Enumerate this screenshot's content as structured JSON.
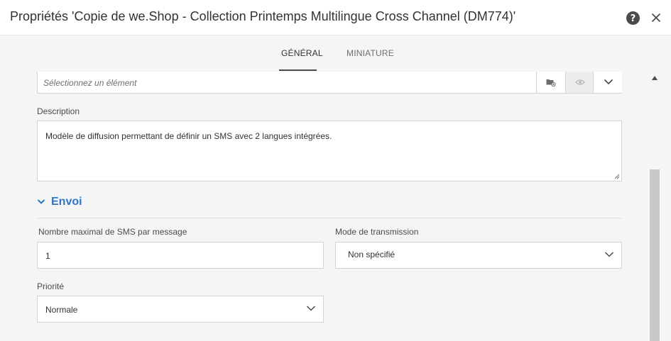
{
  "dialog": {
    "title": "Propriétés 'Copie de we.Shop - Collection Printemps Multilingue Cross Channel (DM774)'"
  },
  "tabs": [
    {
      "label": "GÉNÉRAL",
      "active": true
    },
    {
      "label": "MINIATURE",
      "active": false
    }
  ],
  "select_element": {
    "placeholder": "Sélectionnez un élément"
  },
  "description": {
    "label": "Description",
    "value": "Modèle de diffusion permettant de définir un SMS avec 2 langues intégrées."
  },
  "section_envoi": {
    "title": "Envoi"
  },
  "max_sms": {
    "label": "Nombre maximal de SMS par message",
    "value": "1"
  },
  "transmission_mode": {
    "label": "Mode de transmission",
    "value": "Non spécifié"
  },
  "priority": {
    "label": "Priorité",
    "value": "Normale"
  },
  "colors": {
    "accent": "#2d75c6",
    "text": "#4b4b4b",
    "background": "#f5f5f5"
  },
  "icons": [
    "help-icon",
    "close-icon",
    "folder-icon",
    "eye-icon",
    "chevron-down-icon"
  ]
}
